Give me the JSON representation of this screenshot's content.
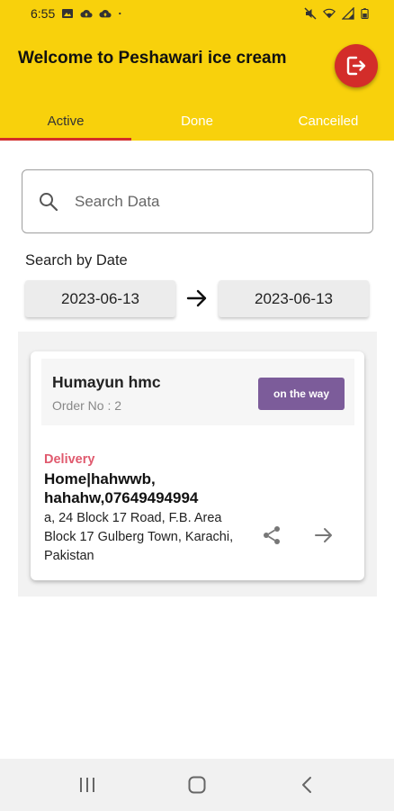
{
  "status_bar": {
    "time": "6:55",
    "left_icons": [
      "image-icon",
      "cloud-upload-icon",
      "cloud-upload-icon",
      "dot-icon"
    ],
    "right_icons": [
      "mute-icon",
      "wifi-icon",
      "signal-icon",
      "battery-icon"
    ]
  },
  "app_bar": {
    "title": "Welcome to Peshawari ice cream",
    "logout_icon": "logout-icon",
    "brand_color": "#f8d10c",
    "accent_color": "#d32d2a"
  },
  "tabs": [
    {
      "label": "Active",
      "active": true
    },
    {
      "label": "Done",
      "active": false
    },
    {
      "label": "Canceiled",
      "active": false
    }
  ],
  "search": {
    "placeholder": "Search Data",
    "value": ""
  },
  "date_filter": {
    "label": "Search by Date",
    "from": "2023-06-13",
    "to": "2023-06-13"
  },
  "orders": [
    {
      "customer_name": "Humayun hmc",
      "order_no": "Order No : 2",
      "status": "on the way",
      "status_color": "#7c5c9a",
      "delivery_label": "Delivery",
      "address_title": "Home|hahwwb, hahahw,07649494994",
      "address_detail": "a, 24 Block 17 Road, F.B. Area Block 17 Gulberg Town, Karachi, Pakistan"
    }
  ],
  "nav_bar": {
    "buttons": [
      "recents-icon",
      "home-icon",
      "back-icon"
    ]
  }
}
